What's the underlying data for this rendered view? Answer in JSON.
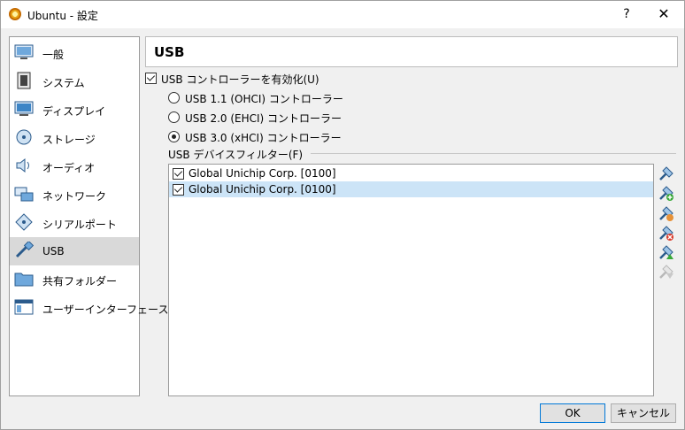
{
  "window": {
    "title": "Ubuntu - 設定",
    "help": "?",
    "close": "✕"
  },
  "sidebar": {
    "items": [
      {
        "label": "一般",
        "icon": "general-icon"
      },
      {
        "label": "システム",
        "icon": "system-icon"
      },
      {
        "label": "ディスプレイ",
        "icon": "display-icon"
      },
      {
        "label": "ストレージ",
        "icon": "storage-icon"
      },
      {
        "label": "オーディオ",
        "icon": "audio-icon"
      },
      {
        "label": "ネットワーク",
        "icon": "network-icon"
      },
      {
        "label": "シリアルポート",
        "icon": "serial-port-icon"
      },
      {
        "label": "USB",
        "icon": "usb-icon",
        "selected": true
      },
      {
        "label": "共有フォルダー",
        "icon": "shared-folder-icon"
      },
      {
        "label": "ユーザーインターフェース",
        "icon": "user-interface-icon"
      }
    ]
  },
  "main": {
    "header": "USB",
    "enable_usb": {
      "label": "USB コントローラーを有効化(U)",
      "checked": true
    },
    "controllers": [
      {
        "label": "USB 1.1 (OHCI) コントローラー",
        "selected": false
      },
      {
        "label": "USB 2.0 (EHCI) コントローラー",
        "selected": false
      },
      {
        "label": "USB 3.0 (xHCI) コントローラー",
        "selected": true
      }
    ],
    "filters_label": "USB デバイスフィルター(F)",
    "filters": [
      {
        "label": "Global Unichip Corp.  [0100]",
        "checked": true
      },
      {
        "label": "Global Unichip Corp.  [0100]",
        "checked": true,
        "selected": true
      }
    ],
    "tools": [
      {
        "icon": "add-empty-filter-icon"
      },
      {
        "icon": "add-filter-from-device-icon"
      },
      {
        "icon": "edit-filter-icon"
      },
      {
        "icon": "remove-filter-icon"
      },
      {
        "icon": "move-filter-up-icon"
      },
      {
        "icon": "move-filter-down-icon"
      }
    ]
  },
  "footer": {
    "ok": "OK",
    "cancel": "キャンセル"
  }
}
